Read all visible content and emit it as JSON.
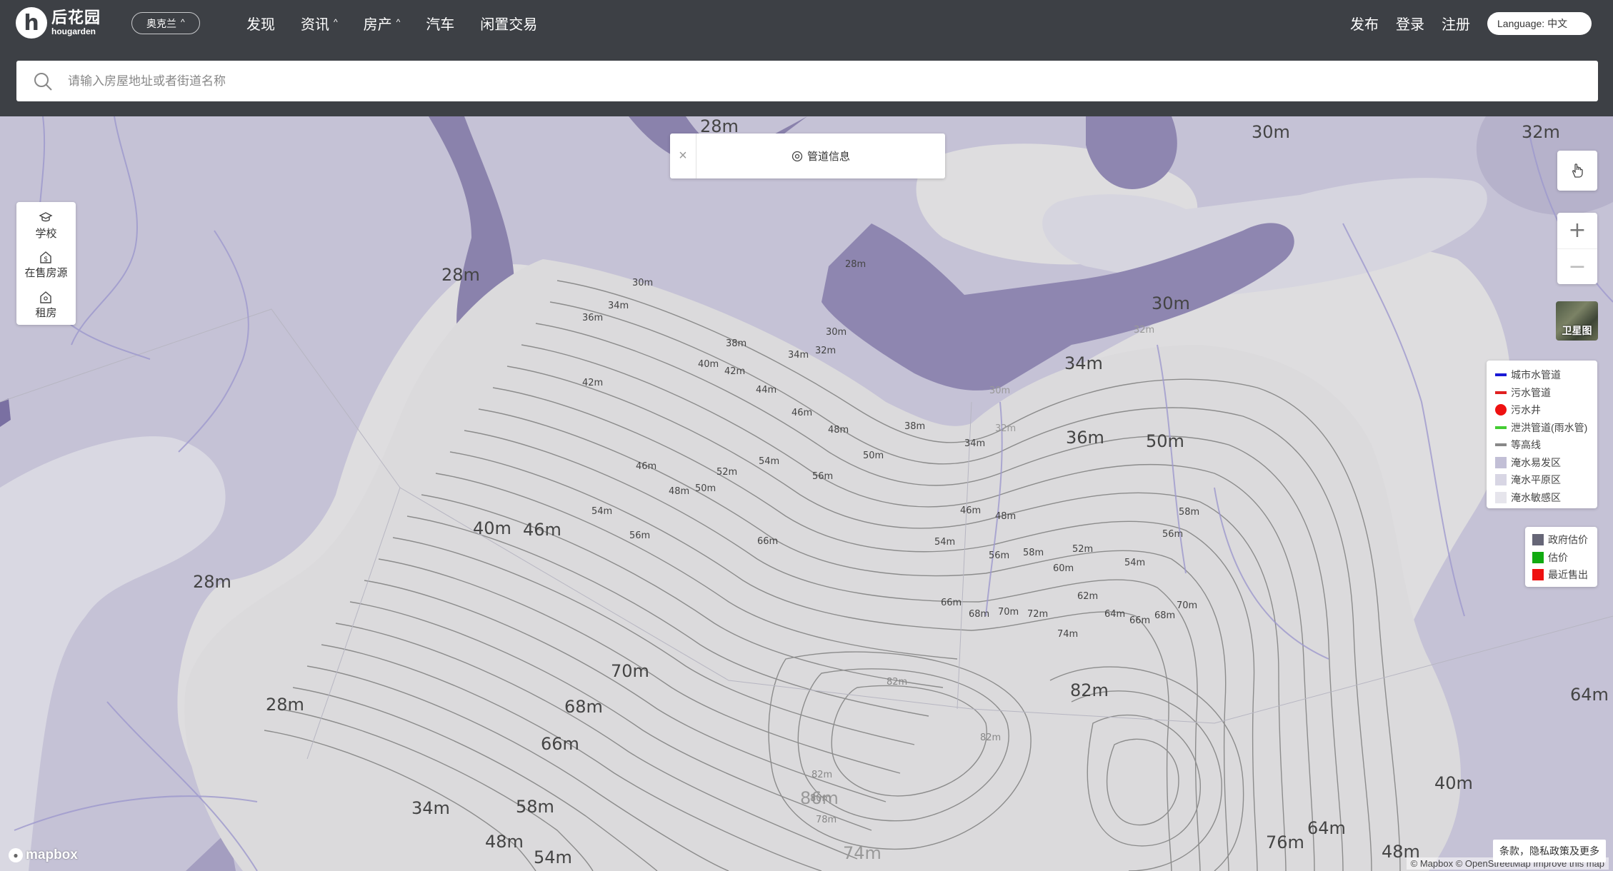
{
  "header": {
    "logo_cn": "后花园",
    "logo_en": "hougarden",
    "logo_glyph": "h",
    "region": "奥克兰",
    "nav": [
      {
        "label": "发现",
        "has_caret": false
      },
      {
        "label": "资讯",
        "has_caret": true
      },
      {
        "label": "房产",
        "has_caret": true
      },
      {
        "label": "汽车",
        "has_caret": false
      },
      {
        "label": "闲置交易",
        "has_caret": false
      }
    ],
    "publish": "发布",
    "login": "登录",
    "register": "注册",
    "language": "Language: 中文"
  },
  "search": {
    "placeholder": "请输入房屋地址或者街道名称",
    "value": ""
  },
  "map": {
    "poi": [
      {
        "label": "学校",
        "icon": "graduation-cap-icon"
      },
      {
        "label": "在售房源",
        "icon": "dollar-house-icon"
      },
      {
        "label": "租房",
        "icon": "key-house-icon"
      }
    ],
    "pipe_panel": {
      "title": "管道信息",
      "close": "×"
    },
    "satellite_label": "卫星图",
    "legend": [
      {
        "label": "城市水管道",
        "type": "line",
        "color": "#1a1ad6"
      },
      {
        "label": "污水管道",
        "type": "line",
        "color": "#e02020"
      },
      {
        "label": "污水井",
        "type": "dot",
        "color": "#ee1111"
      },
      {
        "label": "泄洪管道(雨水管)",
        "type": "line",
        "color": "#44cc33"
      },
      {
        "label": "等高线",
        "type": "line",
        "color": "#888888"
      },
      {
        "label": "淹水易发区",
        "type": "square",
        "color": "#c2bfd6"
      },
      {
        "label": "淹水平原区",
        "type": "square",
        "color": "#d8d6e4"
      },
      {
        "label": "淹水敏感区",
        "type": "square",
        "color": "#e6e5ec"
      }
    ],
    "legend2": [
      {
        "label": "政府估价",
        "color": "#666677"
      },
      {
        "label": "估价",
        "color": "#11aa11"
      },
      {
        "label": "最近售出",
        "color": "#ee1111"
      }
    ],
    "contour_labels": [
      {
        "t": "28m",
        "big": true
      },
      {
        "t": "30m",
        "big": true
      },
      {
        "t": "32m",
        "big": true
      },
      {
        "t": "28m",
        "big": true
      },
      {
        "t": "30m",
        "big": true
      },
      {
        "t": "34m",
        "big": true
      },
      {
        "t": "36m",
        "big": true
      },
      {
        "t": "50m",
        "big": true
      },
      {
        "t": "40m",
        "big": true
      },
      {
        "t": "46m",
        "big": true
      },
      {
        "t": "28m",
        "big": true
      },
      {
        "t": "70m",
        "big": true
      },
      {
        "t": "68m",
        "big": true
      },
      {
        "t": "66m",
        "big": true
      },
      {
        "t": "28m",
        "big": true
      },
      {
        "t": "82m",
        "big": true
      },
      {
        "t": "64m",
        "big": true
      },
      {
        "t": "40m",
        "big": true
      },
      {
        "t": "34m",
        "big": true
      },
      {
        "t": "58m",
        "big": true
      },
      {
        "t": "48m",
        "big": true
      },
      {
        "t": "54m",
        "big": true
      },
      {
        "t": "76m",
        "big": true
      },
      {
        "t": "64m",
        "big": true
      },
      {
        "t": "48m",
        "big": true
      },
      {
        "t": "86m",
        "big": true
      },
      {
        "t": "74m",
        "big": true
      },
      {
        "t": "30m"
      },
      {
        "t": "34m"
      },
      {
        "t": "36m"
      },
      {
        "t": "38m"
      },
      {
        "t": "30m"
      },
      {
        "t": "32m"
      },
      {
        "t": "34m"
      },
      {
        "t": "40m"
      },
      {
        "t": "42m"
      },
      {
        "t": "42m"
      },
      {
        "t": "44m"
      },
      {
        "t": "46m"
      },
      {
        "t": "48m"
      },
      {
        "t": "38m"
      },
      {
        "t": "50m"
      },
      {
        "t": "34m"
      },
      {
        "t": "54m"
      },
      {
        "t": "46m"
      },
      {
        "t": "52m"
      },
      {
        "t": "56m"
      },
      {
        "t": "48m"
      },
      {
        "t": "50m"
      },
      {
        "t": "54m"
      },
      {
        "t": "56m"
      },
      {
        "t": "66m"
      },
      {
        "t": "46m"
      },
      {
        "t": "48m"
      },
      {
        "t": "54m"
      },
      {
        "t": "56m"
      },
      {
        "t": "58m"
      },
      {
        "t": "52m"
      },
      {
        "t": "60m"
      },
      {
        "t": "54m"
      },
      {
        "t": "58m"
      },
      {
        "t": "56m"
      },
      {
        "t": "62m"
      },
      {
        "t": "64m"
      },
      {
        "t": "66m"
      },
      {
        "t": "68m"
      },
      {
        "t": "70m"
      },
      {
        "t": "66m"
      },
      {
        "t": "68m"
      },
      {
        "t": "70m"
      },
      {
        "t": "72m"
      },
      {
        "t": "74m"
      },
      {
        "t": "82m"
      },
      {
        "t": "82m"
      },
      {
        "t": "82m"
      },
      {
        "t": "80m"
      },
      {
        "t": "78m"
      },
      {
        "t": "28m"
      },
      {
        "t": "30m"
      },
      {
        "t": "32m"
      },
      {
        "t": "32m"
      }
    ],
    "mapbox": "mapbox",
    "attribution": "© Mapbox © OpenStreetMap  Improve this map",
    "terms": "条款，隐私政策及更多"
  }
}
